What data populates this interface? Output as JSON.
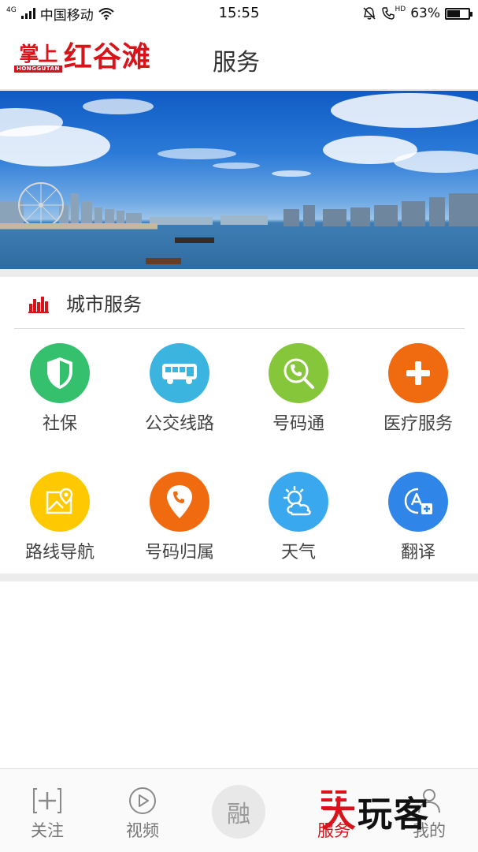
{
  "status_bar": {
    "network_tag": "4G",
    "carrier": "中国移动",
    "time": "15:55",
    "hd_tag": "HD",
    "battery": "63%",
    "battery_level": 0.63,
    "icons": [
      "signal-icon",
      "wifi-icon",
      "mute-bell-icon",
      "hd-call-icon",
      "battery-icon"
    ]
  },
  "header": {
    "logo_small": "掌上",
    "logo_en": "HONGGUTAN",
    "logo_big": "红谷滩",
    "title": "服务"
  },
  "section": {
    "title": "城市服务",
    "icon": "city-skyline-icon"
  },
  "services": [
    {
      "label": "社保",
      "icon": "shield-icon",
      "color": "#35c06d"
    },
    {
      "label": "公交线路",
      "icon": "bus-icon",
      "color": "#3cb4e0"
    },
    {
      "label": "号码通",
      "icon": "phone-search-icon",
      "color": "#85c63b"
    },
    {
      "label": "医疗服务",
      "icon": "medical-cross-icon",
      "color": "#f06a0f"
    },
    {
      "label": "路线导航",
      "icon": "map-pin-icon",
      "color": "#ffc900"
    },
    {
      "label": "号码归属",
      "icon": "phone-location-icon",
      "color": "#f06a0f"
    },
    {
      "label": "天气",
      "icon": "weather-icon",
      "color": "#3aa8ef"
    },
    {
      "label": "翻译",
      "icon": "translate-icon",
      "color": "#2f86e8"
    }
  ],
  "bottom_nav": {
    "items": [
      {
        "label": "关注",
        "icon": "add-follow-icon"
      },
      {
        "label": "视频",
        "icon": "play-icon"
      },
      {
        "label": "融",
        "icon": "fusion-icon"
      },
      {
        "label": "服务",
        "icon": "service-grid-icon"
      },
      {
        "label": "我的",
        "icon": "user-icon"
      }
    ],
    "active_index": 3
  },
  "watermark": {
    "text_a": "大",
    "text_b": "玩客"
  },
  "colors": {
    "brand_red": "#d8141b",
    "divider": "#ececec"
  }
}
